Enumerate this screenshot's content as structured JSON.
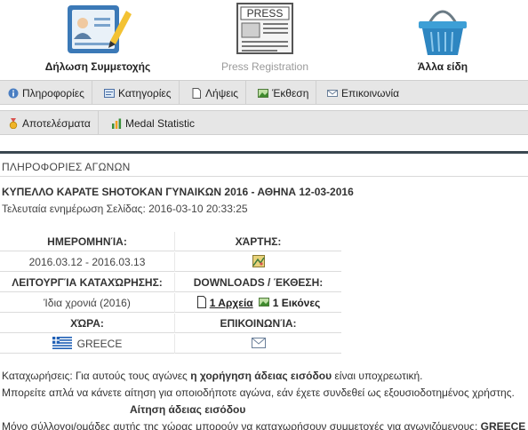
{
  "top": {
    "registration_label": "Δήλωση Συμμετοχής",
    "press_label": "Press Registration",
    "press_icon_text": "PRESS",
    "other_label": "Άλλα είδη"
  },
  "nav1": {
    "info": "Πληροφορίες",
    "categories": "Κατηγορίες",
    "downloads": "Λήψεις",
    "exhibition": "Έκθεση",
    "contact": "Επικοινωνία"
  },
  "nav2": {
    "results": "Αποτελέσματα",
    "medal": "Medal Statistic"
  },
  "section_title": "ΠΛΗΡΟΦΟΡΙΕΣ ΑΓΩΝΩΝ",
  "event": {
    "title": "ΚΥΠΕΛΛΟ ΚΑΡΑΤΕ SHOTOKAN ΓΥΝΑΙΚΩΝ 2016 - ΑΘΗΝΑ 12-03-2016",
    "last_update": "Τελευταία ενημέρωση Σελίδας: 2016-03-10 20:33:25"
  },
  "table": {
    "date_header": "ΗΜΕΡΟΜΗΝΊΑ:",
    "date_value": "2016.03.12 - 2016.03.13",
    "map_header": "ΧΆΡΤΗΣ:",
    "reg_header": "ΛΕΙΤΟΥΡΓΊΑ ΚΑΤΑΧΏΡΗΣΗΣ:",
    "reg_value": "Ίδια χρονιά (2016)",
    "downloads_header": "DOWNLOADS / ΈΚΘΕΣΗ:",
    "files_link": "1 Αρχεία",
    "images_link": "1 Εικόνες",
    "country_header": "ΧΏΡΑ:",
    "country_value": "GREECE",
    "contact_header": "ΕΠΙΚΟΙΝΩΝΊΑ:"
  },
  "notes": {
    "line1_a": "Καταχωρήσεις: Για αυτούς τους αγώνες ",
    "line1_b": "η χορήγηση άδειας εισόδου",
    "line1_c": " είναι υποχρεωτική.",
    "line2": "Μπορείτε απλά να κάνετε αίτηση για οποιοδήποτε αγώνα, εάν έχετε συνδεθεί ως εξουσιοδοτημένος χρήστης.",
    "line3": "Αίτηση άδειας εισόδου",
    "line4_a": "Μόνο σύλλογοι/ομάδες αυτής της χώρας μπορούν να καταχωρήσουν συμμετοχές για αγωνιζόμενους: ",
    "line4_b": "GREECE"
  },
  "colors": {
    "nav_bg": "#e6e6e6",
    "dark_rule": "#3a4750",
    "accent_blue": "#2e86c1"
  }
}
